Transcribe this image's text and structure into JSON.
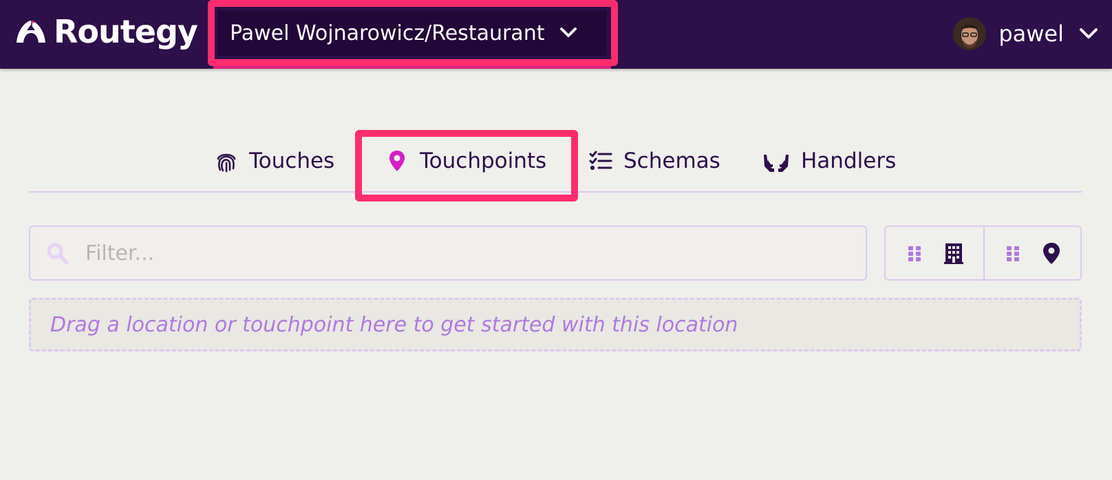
{
  "app": {
    "brand_name": "Routegy"
  },
  "header": {
    "context_selector": "Pawel Wojnarowicz/Restaurant",
    "user_name": "pawel"
  },
  "tabs": [
    {
      "label": "Touches",
      "icon": "fingerprint-icon"
    },
    {
      "label": "Touchpoints",
      "icon": "map-pin-icon",
      "active": true
    },
    {
      "label": "Schemas",
      "icon": "checklist-icon"
    },
    {
      "label": "Handlers",
      "icon": "hands-icon"
    }
  ],
  "filter": {
    "placeholder": "Filter..."
  },
  "view_toggles": [
    {
      "icon": "grid-icon"
    },
    {
      "icon": "building-icon"
    },
    {
      "icon": "grid-icon"
    },
    {
      "icon": "map-pin-icon"
    }
  ],
  "dropzone": {
    "text": "Drag a location or touchpoint here to get started with this location"
  },
  "colors": {
    "header_bg": "#2d0f4a",
    "highlight": "#ff2d6d",
    "accent": "#d61fc6",
    "muted_purple": "#b079dd"
  }
}
